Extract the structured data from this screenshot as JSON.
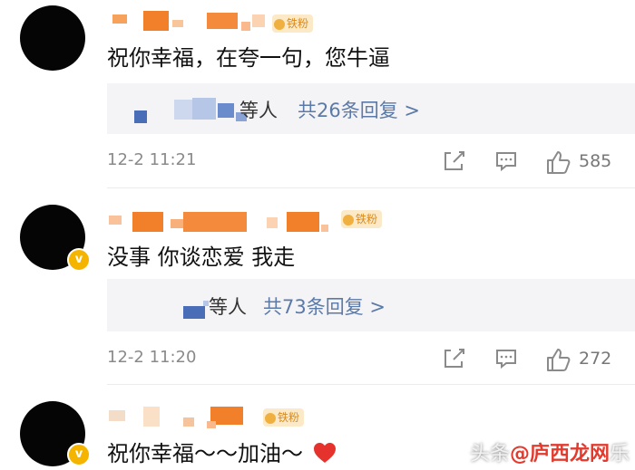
{
  "comments": [
    {
      "badge": "铁粉",
      "text": "祝你幸福，在夸一句，您牛逼",
      "reply_who": "等人",
      "reply_count": "共26条回复 >",
      "time": "12-2 11:21",
      "likes": "585",
      "verified": false
    },
    {
      "badge": "铁粉",
      "text": "没事 你谈恋爱 我走",
      "reply_who": "等人",
      "reply_count": "共73条回复 >",
      "time": "12-2 11:20",
      "likes": "272",
      "verified": true,
      "verified_mark": "v"
    },
    {
      "badge": "铁粉",
      "text": "祝你幸福～～加油～",
      "verified": true,
      "verified_mark": "v",
      "trailing_icon": "heart-icon"
    }
  ],
  "icons": {
    "share": "share-icon",
    "comment": "comment-icon",
    "like": "thumbs-up-icon"
  },
  "colors": {
    "reply_link": "#5b7aa8",
    "badge_bg": "#fbe9c8",
    "badge_text": "#d98a1c",
    "verified": "#f5b400",
    "heart": "#e5322d"
  },
  "watermark": {
    "prefix": "头条",
    "brand": "@庐西龙网",
    "suffix": "乐"
  }
}
